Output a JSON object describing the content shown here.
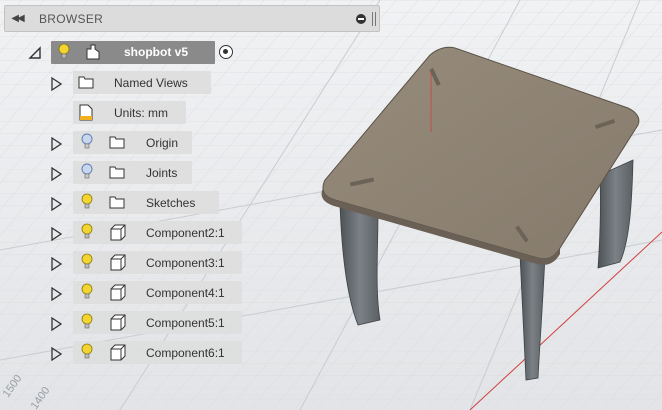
{
  "browser": {
    "title": "BROWSER"
  },
  "tree": {
    "root": {
      "label": "shopbot v5"
    },
    "items": [
      {
        "label": "Named Views",
        "icon": "folder-icon",
        "bulb": "none",
        "expander": true
      },
      {
        "label": "Units: mm",
        "icon": "document-icon",
        "bulb": "none",
        "expander": false
      },
      {
        "label": "Origin",
        "icon": "folder-icon",
        "bulb": "off",
        "expander": true
      },
      {
        "label": "Joints",
        "icon": "folder-icon",
        "bulb": "off",
        "expander": true
      },
      {
        "label": "Sketches",
        "icon": "folder-icon",
        "bulb": "on",
        "expander": true
      },
      {
        "label": "Component2:1",
        "icon": "component-icon",
        "bulb": "on",
        "expander": true
      },
      {
        "label": "Component3:1",
        "icon": "component-icon",
        "bulb": "on",
        "expander": true
      },
      {
        "label": "Component4:1",
        "icon": "component-icon",
        "bulb": "on",
        "expander": true
      },
      {
        "label": "Component5:1",
        "icon": "component-icon",
        "bulb": "on",
        "expander": true
      },
      {
        "label": "Component6:1",
        "icon": "component-icon",
        "bulb": "on",
        "expander": true
      }
    ]
  },
  "grid_labels": [
    "1500",
    "1400"
  ],
  "colors": {
    "table_top": "#8f8475",
    "table_legs": "#6d7378",
    "bulb_on": "#f2d530",
    "bulb_off": "#9fb4d8",
    "axis_red": "#d04040"
  }
}
